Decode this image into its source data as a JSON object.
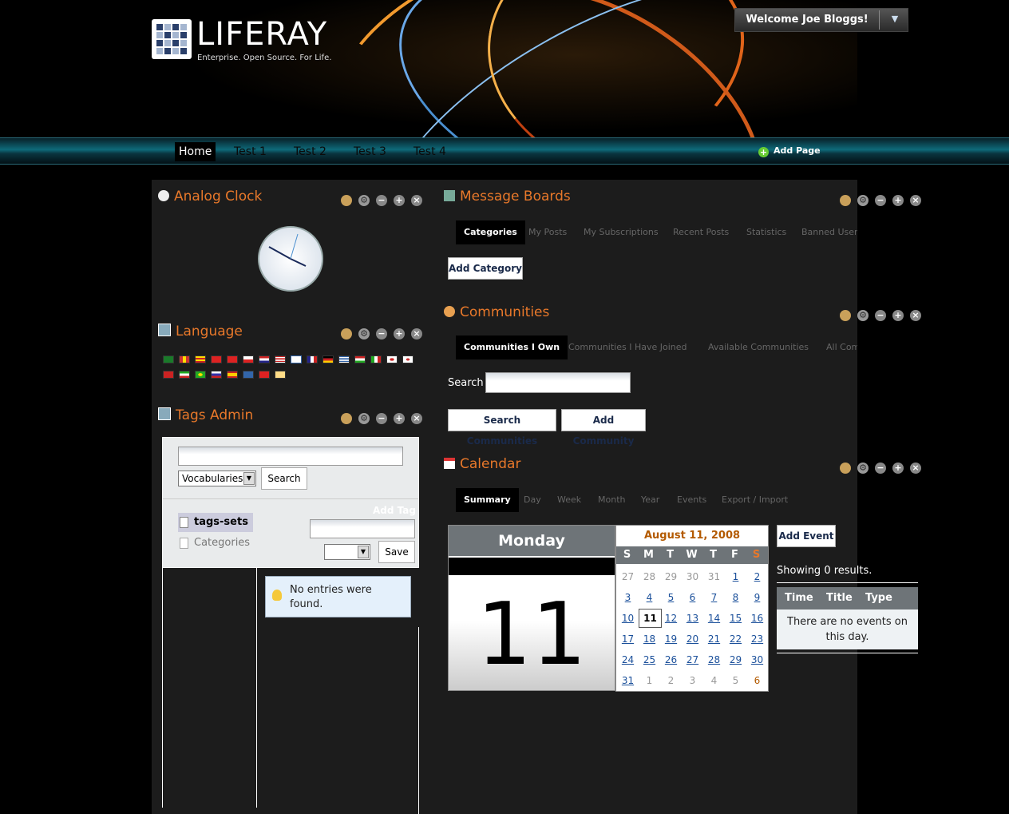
{
  "header": {
    "logo_word": "LIFERAY",
    "logo_tagline": "Enterprise. Open Source. For Life.",
    "welcome": "Welcome Joe Bloggs!"
  },
  "nav": {
    "items": [
      "Home",
      "Test 1",
      "Test 2",
      "Test 3",
      "Test 4"
    ],
    "selected": "Home",
    "add_page": "Add Page"
  },
  "portlets": {
    "analog_clock": {
      "title": "Analog Clock"
    },
    "language": {
      "title": "Language",
      "flags": [
        "arabic-flag",
        "catalan-flag",
        "catalan-alt-flag",
        "chinese-flag",
        "taiwan-flag",
        "czech-flag",
        "dutch-flag",
        "english-flag",
        "finnish-flag",
        "french-flag",
        "german-flag",
        "greek-flag",
        "hungarian-flag",
        "italian-flag",
        "japanese-flag",
        "korean-flag",
        "norwegian-flag",
        "persian-flag",
        "portuguese-flag",
        "russian-flag",
        "spanish-flag",
        "swedish-flag",
        "turkish-flag",
        "vietnamese-flag"
      ]
    },
    "tags_admin": {
      "title": "Tags Admin",
      "select_value": "Vocabularies",
      "search_button": "Search",
      "add_tag": "Add Tag",
      "tree": [
        "tags-sets",
        "Categories"
      ],
      "save_button": "Save",
      "no_entries": "No entries were found."
    },
    "message_boards": {
      "title": "Message Boards",
      "tabs": [
        "Categories",
        "My Posts",
        "My Subscriptions",
        "Recent Posts",
        "Statistics",
        "Banned Users"
      ],
      "add_button": "Add Category"
    },
    "communities": {
      "title": "Communities",
      "tabs": [
        "Communities I Own",
        "Communities I Have Joined",
        "Available Communities",
        "All Communities"
      ],
      "search_label": "Search",
      "search_button": "Search Communities",
      "add_button": "Add Community"
    },
    "calendar": {
      "title": "Calendar",
      "tabs": [
        "Summary",
        "Day",
        "Week",
        "Month",
        "Year",
        "Events",
        "Export / Import"
      ],
      "day_name": "Monday",
      "day_number": "11",
      "month_title": "August 11, 2008",
      "weekdays": [
        "S",
        "M",
        "T",
        "W",
        "T",
        "F",
        "S"
      ],
      "weeks": [
        [
          "27",
          "28",
          "29",
          "30",
          "31",
          "1",
          "2"
        ],
        [
          "3",
          "4",
          "5",
          "6",
          "7",
          "8",
          "9"
        ],
        [
          "10",
          "11",
          "12",
          "13",
          "14",
          "15",
          "16"
        ],
        [
          "17",
          "18",
          "19",
          "20",
          "21",
          "22",
          "23"
        ],
        [
          "24",
          "25",
          "26",
          "27",
          "28",
          "29",
          "30"
        ],
        [
          "31",
          "1",
          "2",
          "3",
          "4",
          "5",
          "6"
        ]
      ],
      "add_event": "Add Event",
      "showing": "Showing 0 results.",
      "columns": [
        "Time",
        "Title",
        "Type"
      ],
      "no_events": "There are no events on this day."
    }
  },
  "colors": {
    "accent": "#e8782a",
    "content_bg": "#1c1c1c",
    "nav_teal": "#0e6a7a",
    "calendar_header": "#6e7478"
  }
}
